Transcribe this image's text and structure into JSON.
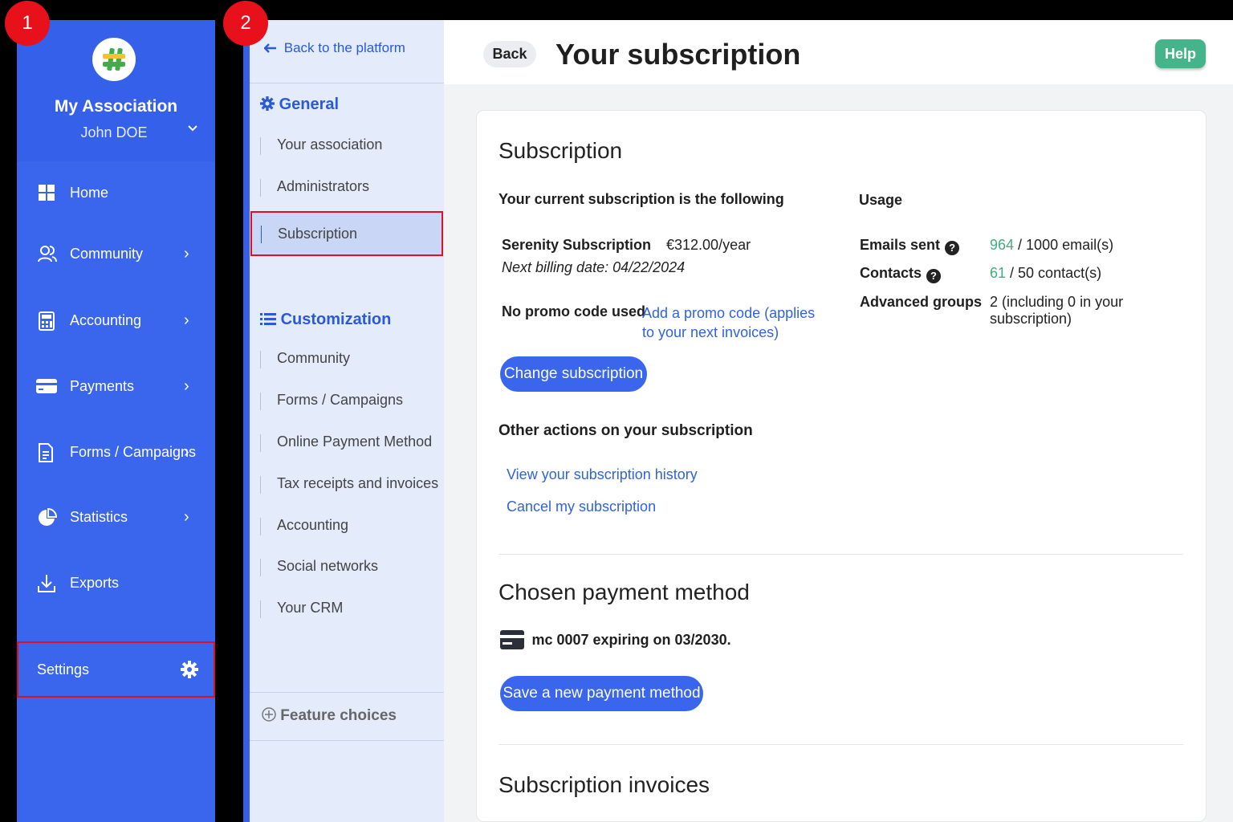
{
  "markers": [
    "1",
    "2"
  ],
  "org": {
    "name": "My Association",
    "user": "John DOE"
  },
  "nav": {
    "home": "Home",
    "community": "Community",
    "accounting": "Accounting",
    "payments": "Payments",
    "forms": "Forms / Campaigns",
    "statistics": "Statistics",
    "exports": "Exports",
    "settings": "Settings"
  },
  "settings_menu": {
    "back": "Back to the platform",
    "general_title": "General",
    "general_items": [
      "Your association",
      "Administrators",
      "Subscription"
    ],
    "customization_title": "Customization",
    "customization_items": [
      "Community",
      "Forms / Campaigns",
      "Online Payment Method",
      "Tax receipts and invoices",
      "Accounting",
      "Social networks",
      "Your CRM"
    ],
    "feature_choices": "Feature choices"
  },
  "header": {
    "back": "Back",
    "title": "Your subscription",
    "help": "Help"
  },
  "subscription": {
    "heading": "Subscription",
    "current_label": "Your current subscription is the following",
    "plan_name": "Serenity Subscription",
    "plan_price": "€312.00/year",
    "next_billing": "Next billing date: 04/22/2024",
    "promo_label": "No promo code used",
    "promo_link_1": "Add a promo code (applies",
    "promo_link_2": "to your next invoices)",
    "change_button": "Change subscription",
    "other_actions": "Other actions on your subscription",
    "history_link": "View your subscription history",
    "cancel_link": "Cancel my subscription"
  },
  "usage": {
    "title": "Usage",
    "emails_label": "Emails sent",
    "emails_used": "964",
    "emails_total": " / 1000 email(s)",
    "contacts_label": "Contacts",
    "contacts_used": "61",
    "contacts_total": " / 50 contact(s)",
    "groups_label": "Advanced groups",
    "groups_value": "2 (including 0 in your subscription)"
  },
  "payment": {
    "heading": "Chosen payment method",
    "card_text": "mc 0007 expiring on 03/2030.",
    "save_button": "Save a new payment method"
  },
  "invoices": {
    "heading": "Subscription invoices"
  },
  "colors": {
    "primary": "#3a66ee",
    "accent_green": "#45b48a",
    "highlight": "#e01020"
  }
}
